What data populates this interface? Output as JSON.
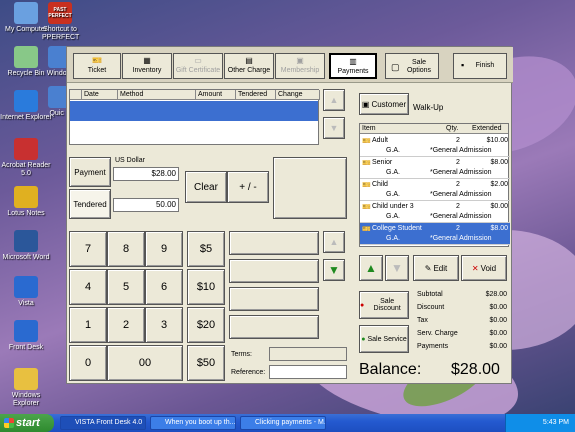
{
  "desktop": {
    "icons": [
      {
        "label": "My Computer",
        "icon": "computer-icon",
        "color": "#6aa0e0"
      },
      {
        "label": "Recycle Bin",
        "icon": "recycle-bin-icon",
        "color": "#88c888"
      },
      {
        "label": "Internet Explorer",
        "icon": "ie-icon",
        "color": "#2a7bdc"
      },
      {
        "label": "Acrobat Reader 5.0",
        "icon": "acrobat-icon",
        "color": "#c83030"
      },
      {
        "label": "Lotus Notes",
        "icon": "lotus-icon",
        "color": "#e0b020"
      },
      {
        "label": "Microsoft Word",
        "icon": "word-icon",
        "color": "#2b579a"
      },
      {
        "label": "Vista",
        "icon": "vista-icon",
        "color": "#2a6ad0"
      },
      {
        "label": "Front Desk",
        "icon": "front-desk-icon",
        "color": "#2a6ad0"
      },
      {
        "label": "Windows Explorer",
        "icon": "explorer-icon",
        "color": "#e8c040"
      }
    ],
    "icons2": [
      {
        "label": "Shortcut to PPERFECT",
        "icon": "pperfect-icon",
        "color": "#c83020",
        "badge": "PAST PERFECT"
      },
      {
        "label": "Windo P",
        "icon": "window-icon",
        "color": "#4a80d0"
      },
      {
        "label": "Quic P",
        "icon": "quick-icon",
        "color": "#4a80d0"
      }
    ]
  },
  "toolbar": {
    "ticket": "Ticket",
    "inventory": "Inventory",
    "gift_certificate": "Gift Certificate",
    "other_charge": "Other Charge",
    "membership": "Membership",
    "payments": "Payments",
    "sale_options": "Sale Options",
    "finish": "Finish"
  },
  "payments_grid": {
    "headers": [
      "Date",
      "Method",
      "Amount",
      "Tendered",
      "Change"
    ]
  },
  "payment": {
    "payment_label": "Payment",
    "tendered_label": "Tendered",
    "currency": "US Dollar",
    "amount": "$28.00",
    "tendered": "50.00",
    "clear": "Clear",
    "plus_minus": "+ / -"
  },
  "keypad": {
    "keys": [
      "7",
      "8",
      "9",
      "4",
      "5",
      "6",
      "1",
      "2",
      "3",
      "0",
      "00"
    ],
    "cash": [
      "$5",
      "$10",
      "$20",
      "$50"
    ]
  },
  "fields": {
    "terms_label": "Terms:",
    "reference_label": "Reference:"
  },
  "customer": {
    "button": "Customer",
    "value": "Walk-Up"
  },
  "cart": {
    "headers": [
      "Item",
      "Qty.",
      "Extended"
    ],
    "items": [
      {
        "name": "Adult",
        "qty": "2",
        "ext": "$10.00",
        "sub": "G.A.",
        "note": "*General Admission"
      },
      {
        "name": "Senior",
        "qty": "2",
        "ext": "$8.00",
        "sub": "G.A.",
        "note": "*General Admission"
      },
      {
        "name": "Child",
        "qty": "2",
        "ext": "$2.00",
        "sub": "G.A.",
        "note": "*General Admission"
      },
      {
        "name": "Child under 3",
        "qty": "2",
        "ext": "$0.00",
        "sub": "G.A.",
        "note": "*General Admission"
      },
      {
        "name": "College Student",
        "qty": "2",
        "ext": "$8.00",
        "sub": "G.A.",
        "note": "*General Admission"
      }
    ],
    "edit": "Edit",
    "void": "Void"
  },
  "discounts": {
    "sale_discount": "Sale Discount",
    "sale_service": "Sale Service"
  },
  "summary": {
    "rows": [
      {
        "label": "Subtotal",
        "value": "$28.00"
      },
      {
        "label": "Discount",
        "value": "$0.00"
      },
      {
        "label": "Tax",
        "value": "$0.00"
      },
      {
        "label": "Serv. Charge",
        "value": "$0.00"
      },
      {
        "label": "Payments",
        "value": "$0.00"
      }
    ],
    "balance_label": "Balance:",
    "balance_value": "$28.00"
  },
  "taskbar": {
    "start": "start",
    "tasks": [
      "VISTA Front Desk 4.0",
      "When you boot up th...",
      "Clicking payments - M..."
    ],
    "clock": "5:43 PM"
  }
}
